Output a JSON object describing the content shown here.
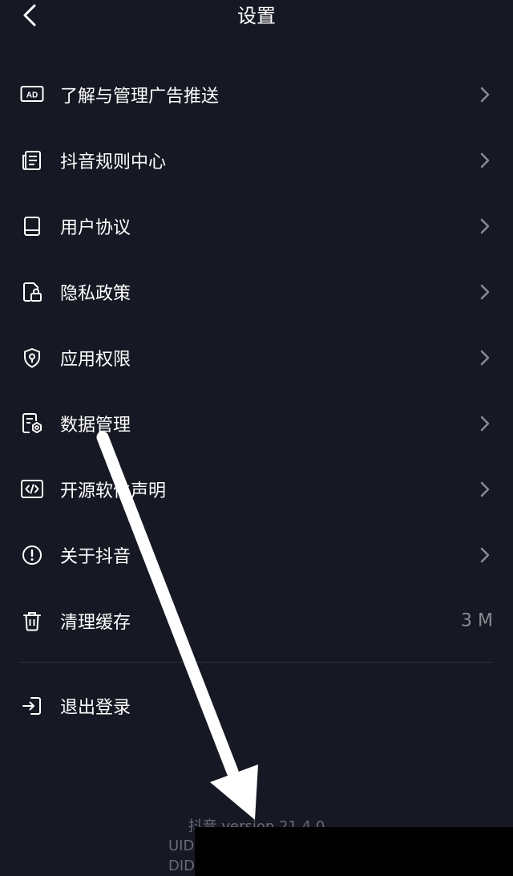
{
  "header": {
    "title": "设置"
  },
  "menu": {
    "items": [
      {
        "label": "了解与管理广告推送",
        "icon": "ad-icon"
      },
      {
        "label": "抖音规则中心",
        "icon": "document-list-icon"
      },
      {
        "label": "用户协议",
        "icon": "book-icon"
      },
      {
        "label": "隐私政策",
        "icon": "privacy-lock-icon"
      },
      {
        "label": "应用权限",
        "icon": "shield-icon"
      },
      {
        "label": "数据管理",
        "icon": "data-settings-icon"
      },
      {
        "label": "开源软件声明",
        "icon": "code-icon"
      },
      {
        "label": "关于抖音",
        "icon": "info-icon"
      },
      {
        "label": "清理缓存",
        "icon": "trash-icon",
        "value": "3 M"
      }
    ]
  },
  "logout": {
    "label": "退出登录",
    "icon": "logout-icon"
  },
  "footer": {
    "version": "抖音 version 21.4.0",
    "uid_label": "UID",
    "did_label": "DID"
  },
  "colors": {
    "background": "#161823",
    "text": "#ffffff",
    "muted": "#8a8b91",
    "annotation_arrow": "#ffffff"
  }
}
